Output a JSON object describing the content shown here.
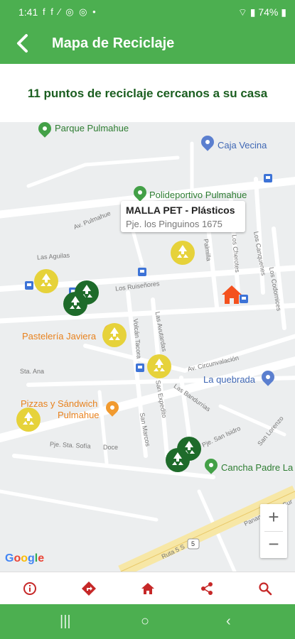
{
  "status_bar": {
    "time": "1:41",
    "notifications": "f f ⁄ ◎ ◎ •",
    "battery": "74%"
  },
  "app_bar": {
    "title": "Mapa de Reciclaje"
  },
  "subtitle": "11 puntos de reciclaje cercanos a su casa",
  "map": {
    "pois": {
      "parque": "Parque Pulmahue",
      "caja": "Caja Vecina",
      "polideportivo": "Polideportivo Pulmahue",
      "pasteleria": "Pastelería Javiera",
      "quebrada": "La quebrada",
      "pizzas_line1": "Pizzas y Sándwich",
      "pizzas_line2": "Pulmahue",
      "cancha": "Cancha Padre La"
    },
    "streets": {
      "pulmahue": "Av. Pulmahue",
      "aguilas": "Las Aguilas",
      "ruisenores": "Los Ruiseñores",
      "palmilla": "Palmilla",
      "cheroles": "Los Cherotes",
      "canquenes": "Los Canquenes",
      "codornices": "Los Codornices",
      "volcan": "Volcán Tacora",
      "avutardas": "Las Avutardas",
      "circunvalacion": "Av. Circunvalación",
      "sta_ana": "Sta. Ana",
      "san_expedito": "San Expedito",
      "bandurrias": "Las Bandurrias",
      "san_marcos": "San Marcos",
      "san_isidro": "Pje. San Isidro",
      "san_lorenzo": "San Lorenzo",
      "sta_sofia": "Pje. Sta. Sofía",
      "doce": "Doce",
      "panamericana": "Panamericana Sur",
      "ruta": "Ruta 5 S",
      "ruta_shield": "5"
    },
    "tooltip": {
      "title": "MALLA PET - Plásticos",
      "address": "Pje. los Pinguinos 1675"
    },
    "zoom_in": "+",
    "zoom_out": "−",
    "attribution": "Google"
  },
  "bottom_nav": [
    {
      "name": "info",
      "icon": "info-icon"
    },
    {
      "name": "route",
      "icon": "directions-icon"
    },
    {
      "name": "home",
      "icon": "home-icon"
    },
    {
      "name": "share",
      "icon": "share-icon"
    },
    {
      "name": "search",
      "icon": "search-icon"
    }
  ],
  "colors": {
    "brand_green": "#4caf50",
    "title_green": "#1b5e20",
    "nav_red": "#c62828",
    "recycle_yellow": "#e6d23a",
    "recycle_green": "#1e6b2a",
    "house_orange": "#f4511e"
  },
  "system_nav": {
    "recents": "|||",
    "home": "○",
    "back": "‹"
  }
}
